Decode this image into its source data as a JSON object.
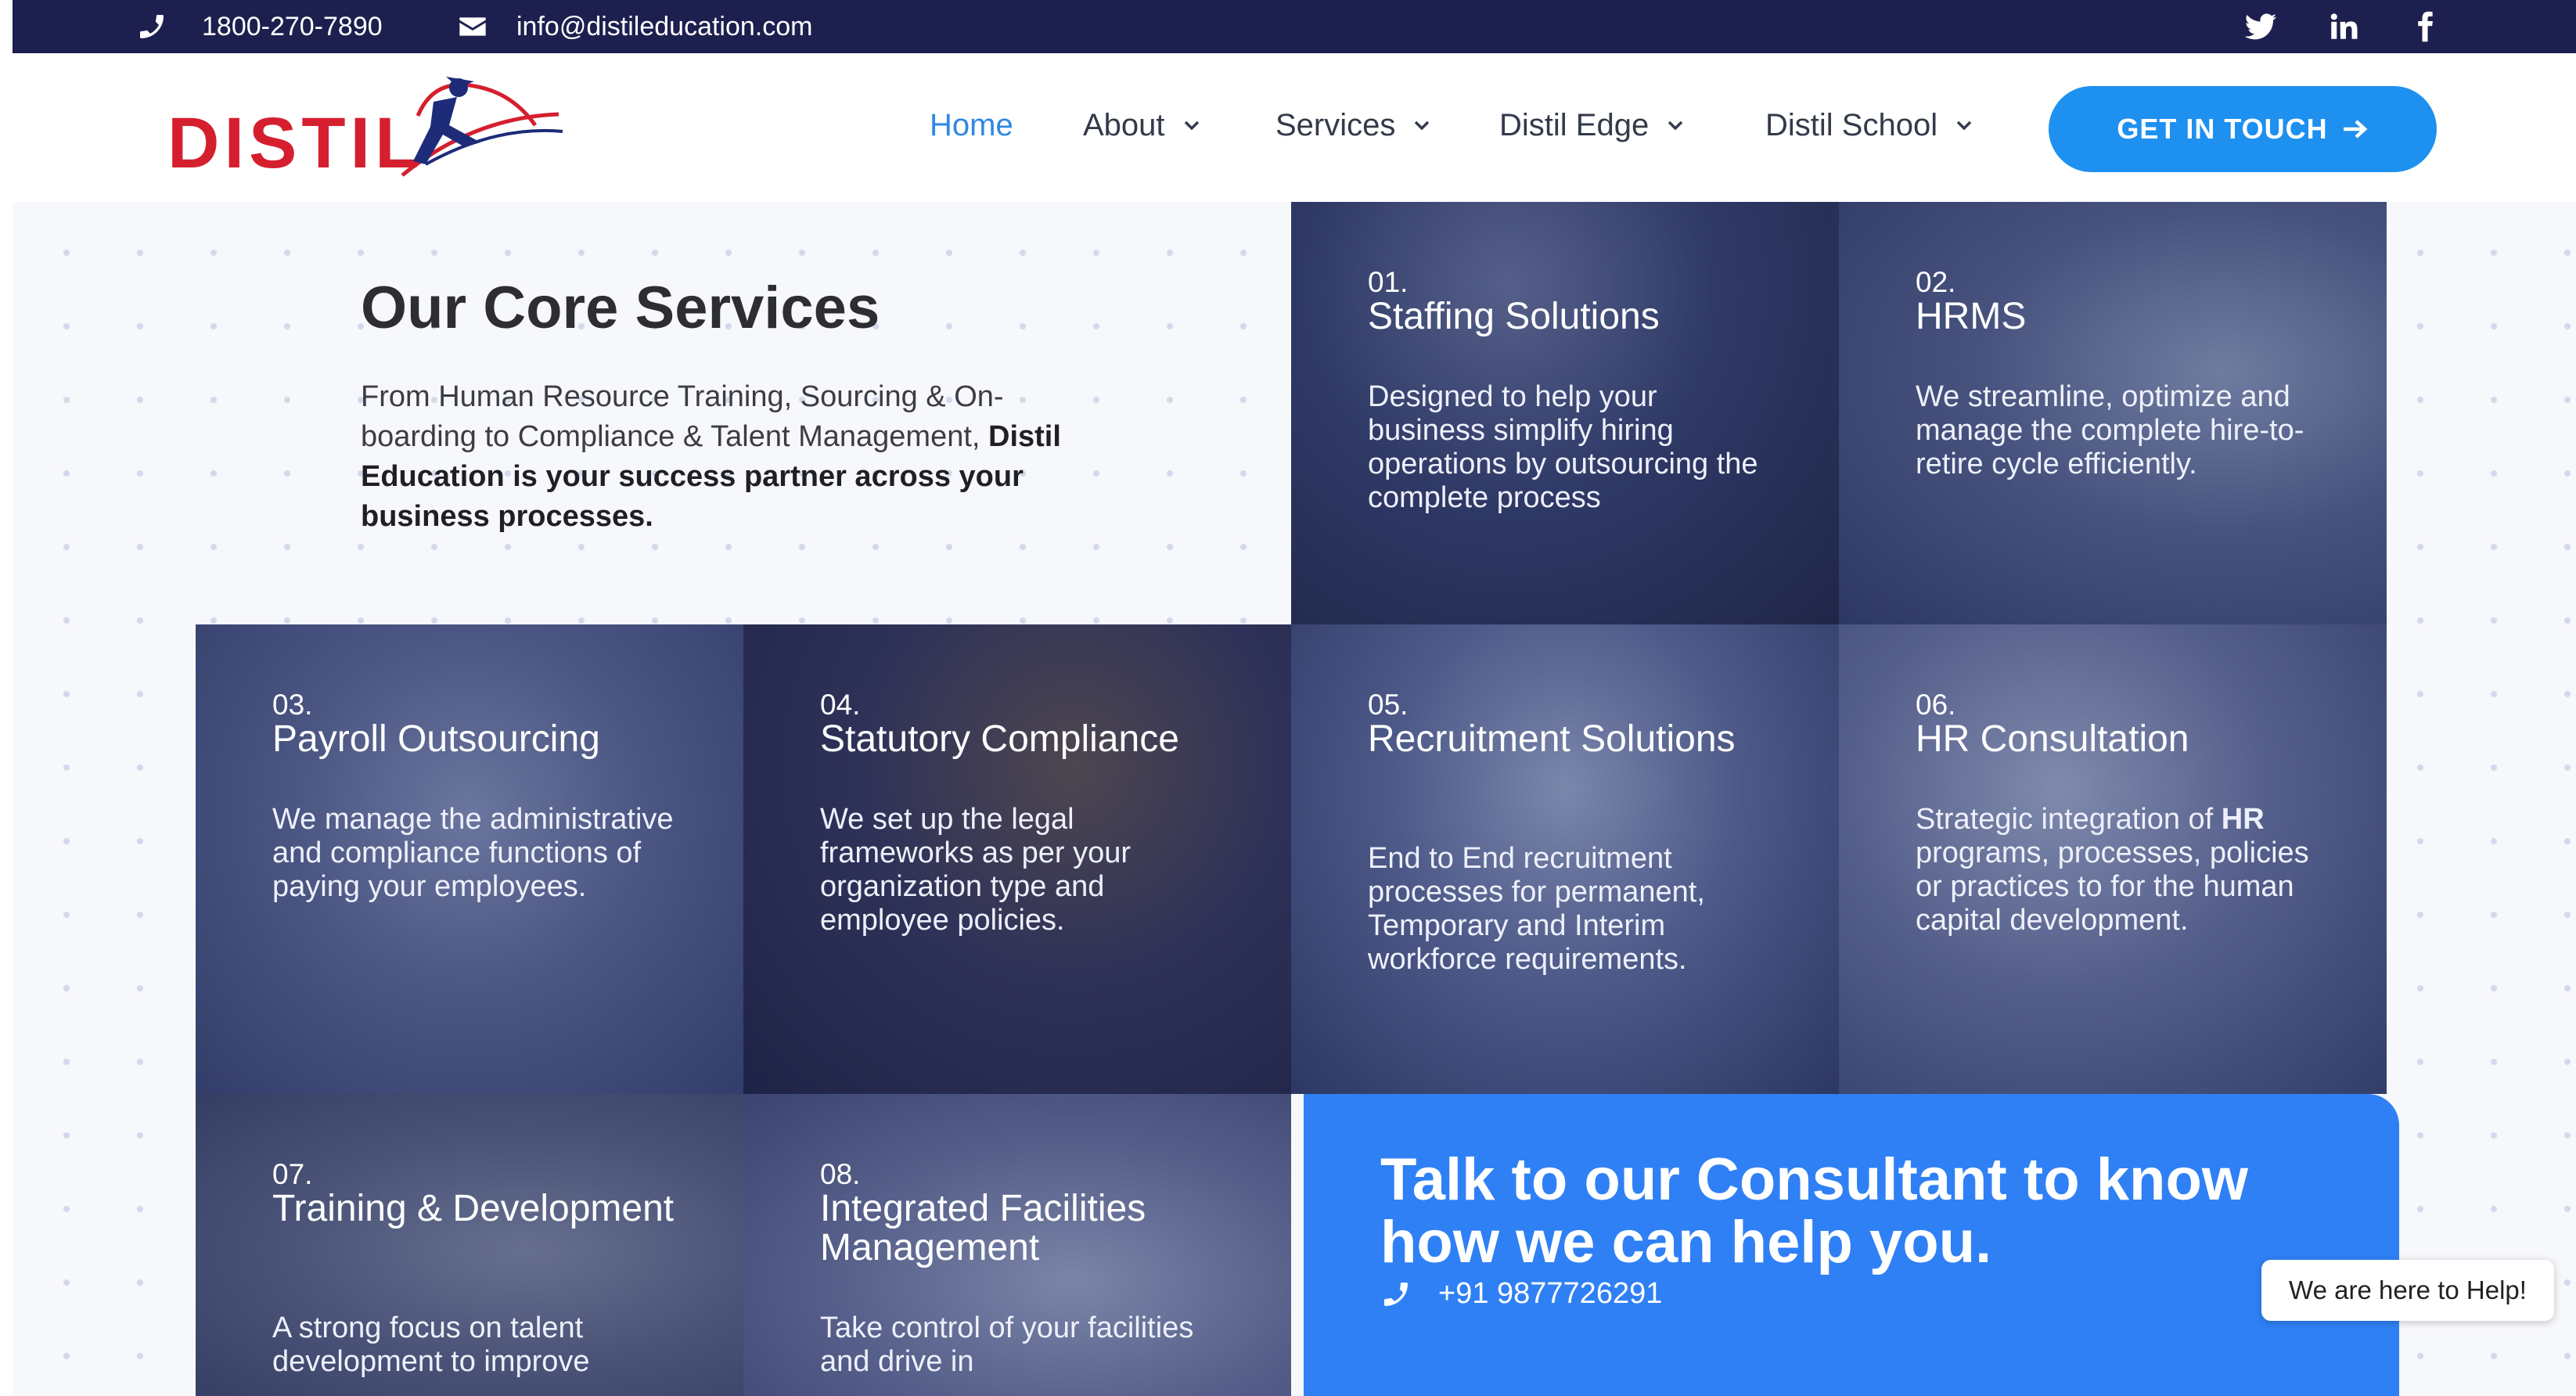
{
  "topbar": {
    "phone_icon": "phone-icon",
    "phone": "1800-270-7890",
    "email_icon": "envelope-icon",
    "email": "info@distileducation.com",
    "social": [
      "twitter-icon",
      "linkedin-icon",
      "facebook-icon"
    ]
  },
  "header": {
    "logo_text": "DISTIL",
    "nav": [
      {
        "label": "Home",
        "active": true
      },
      {
        "label": "About",
        "dropdown": true
      },
      {
        "label": "Services",
        "dropdown": true
      },
      {
        "label": "Distil Edge",
        "dropdown": true
      },
      {
        "label": "Distil School",
        "dropdown": true
      }
    ],
    "cta_label": "GET IN TOUCH",
    "cta_icon": "arrow-right-icon"
  },
  "intro": {
    "title": "Our Core Services",
    "text_1": "From Human Resource Training, Sourcing & On-boarding to Compliance & Talent Management,",
    "text_2": "Distil Education is your success partner across your business processes."
  },
  "services": [
    {
      "num": "01.",
      "title": "Staffing Solutions",
      "desc": "Designed to help your business simplify hiring operations by outsourcing the complete process"
    },
    {
      "num": "02.",
      "title": "HRMS",
      "desc": "We streamline, optimize and manage the complete hire-to-retire cycle efficiently."
    },
    {
      "num": "03.",
      "title": "Payroll Outsourcing",
      "desc": "We manage the administrative and compliance functions of paying your employees."
    },
    {
      "num": "04.",
      "title": "Statutory Compliance",
      "desc": "We set up the legal frameworks as per your organization type and employee policies."
    },
    {
      "num": "05.",
      "title": "Recruitment Solutions",
      "desc": "End to End recruitment processes for permanent, Temporary and Interim workforce requirements."
    },
    {
      "num": "06.",
      "title": "HR Consultation",
      "desc_1": "Strategic integration of",
      "desc_bold": "HR",
      "desc_2": "programs, processes, policies or practices to for the human capital development."
    },
    {
      "num": "07.",
      "title": "Training & Development",
      "desc": "A strong focus on  talent development to improve"
    },
    {
      "num": "08.",
      "title": "Integrated Facilities Management",
      "desc": "Take control of your facilities and drive in"
    }
  ],
  "consult": {
    "title": "Talk to our Consultant to know how we can help you.",
    "phone": "+91 9877726291",
    "phone_icon": "phone-icon"
  },
  "help_text": "We are here to Help!",
  "colors": {
    "topbar_bg": "#1d1f4e",
    "accent": "#1e90f0",
    "tile_overlay": "#2b3560",
    "consult_bg": "#2f80f5",
    "nav_active": "#2f88e4"
  }
}
